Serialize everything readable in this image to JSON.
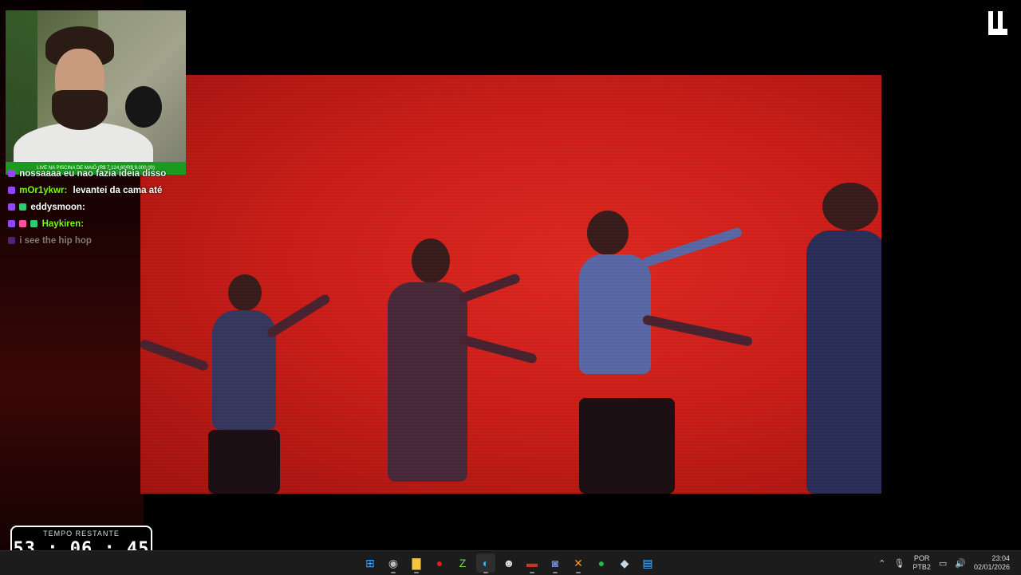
{
  "webcam": {
    "banner": "LIVE NA PISCINA DE MAIÔ (R$ 7.124,60/R$ 9.000,00)"
  },
  "chat": {
    "messages": [
      {
        "user": "",
        "text": "nossaaaa eu nao fazia ideia disso",
        "user_color": "#9b5cff",
        "faded": false
      },
      {
        "user": "mOr1ykwr:",
        "text": "levantei da cama até",
        "user_color": "#5cff5c",
        "faded": false
      },
      {
        "user": "eddysmoon:",
        "text": "",
        "user_color": "#ffffff",
        "faded": false
      },
      {
        "user": "Haykiren:",
        "text": "",
        "user_color": "#5cff5c",
        "faded": false
      },
      {
        "user": "",
        "text": "i see the hip hop",
        "user_color": "#9b5cff",
        "faded": true
      }
    ]
  },
  "timer": {
    "label": "TEMPO RESTANTE",
    "value": "53 : 06 : 45"
  },
  "taskbar": {
    "icons": [
      {
        "name": "windows-start-icon",
        "glyph": "⊞",
        "color": "#3aa0ff"
      },
      {
        "name": "obs-icon",
        "glyph": "◉",
        "color": "#bbbbbb"
      },
      {
        "name": "file-explorer-icon",
        "glyph": "▇",
        "color": "#f5c542"
      },
      {
        "name": "app-red-icon",
        "glyph": "●",
        "color": "#e02020"
      },
      {
        "name": "notepad-plus-icon",
        "glyph": "Z",
        "color": "#7bd148"
      },
      {
        "name": "edge-icon",
        "glyph": "◐",
        "color": "#2fb7e8"
      },
      {
        "name": "ghost-app-icon",
        "glyph": "☻",
        "color": "#dddddd"
      },
      {
        "name": "hidden-app-icon",
        "glyph": "▬",
        "color": "#c0392b"
      },
      {
        "name": "discord-icon",
        "glyph": "◙",
        "color": "#7289da"
      },
      {
        "name": "git-icon",
        "glyph": "✕",
        "color": "#f39c12"
      },
      {
        "name": "spotify-icon",
        "glyph": "●",
        "color": "#1db954"
      },
      {
        "name": "steam-icon",
        "glyph": "◆",
        "color": "#c7d5e0"
      },
      {
        "name": "notepad-icon",
        "glyph": "▤",
        "color": "#4fb6ff"
      }
    ],
    "tray": {
      "lang_top": "POR",
      "lang_bottom": "PTB2",
      "time": "23:04",
      "date": "02/01/2026"
    }
  }
}
